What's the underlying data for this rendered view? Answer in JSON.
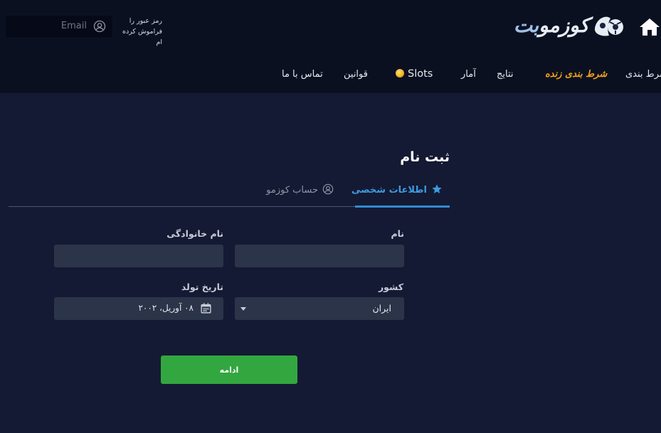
{
  "header": {
    "email_placeholder": "Email",
    "forgot_password_line1": "رمز عبور را",
    "forgot_password_line2": "فراموش کرده ام",
    "logo_text_main": "کوزمو",
    "logo_text_accent": "بت",
    "icons": [
      "user-icon",
      "logo-ball-icon",
      "home-icon"
    ]
  },
  "nav": {
    "items": [
      {
        "label": "شرط بندی"
      },
      {
        "label": "شرط بندی زنده",
        "highlight": true,
        "color": "#f4a21b"
      },
      {
        "label": "نتایج"
      },
      {
        "label": "آمار"
      },
      {
        "label": "Slots",
        "icon": "coin-icon"
      },
      {
        "label": "قوانین"
      },
      {
        "label": "تماس با ما"
      }
    ]
  },
  "form": {
    "title": "ثبت نام",
    "tabs": [
      {
        "label": "اطلاعات شخصی",
        "icon": "star-icon",
        "active": true
      },
      {
        "label": "حساب کوزمو",
        "icon": "user-icon",
        "active": false
      }
    ],
    "first_name": {
      "label": "نام",
      "value": ""
    },
    "last_name": {
      "label": "نام خانوادگی",
      "value": ""
    },
    "country": {
      "label": "کشور",
      "value": "ایران"
    },
    "birth_date": {
      "label": "تاریخ تولد",
      "value": "۰۸ آوریل، ۲۰۰۲"
    },
    "continue_label": "ادامه"
  },
  "colors": {
    "accent_blue": "#2f8bd1",
    "button_green": "#33a73f",
    "live_orange": "#f4a21b",
    "background": "#141a33",
    "header_bg": "#0b1021"
  }
}
